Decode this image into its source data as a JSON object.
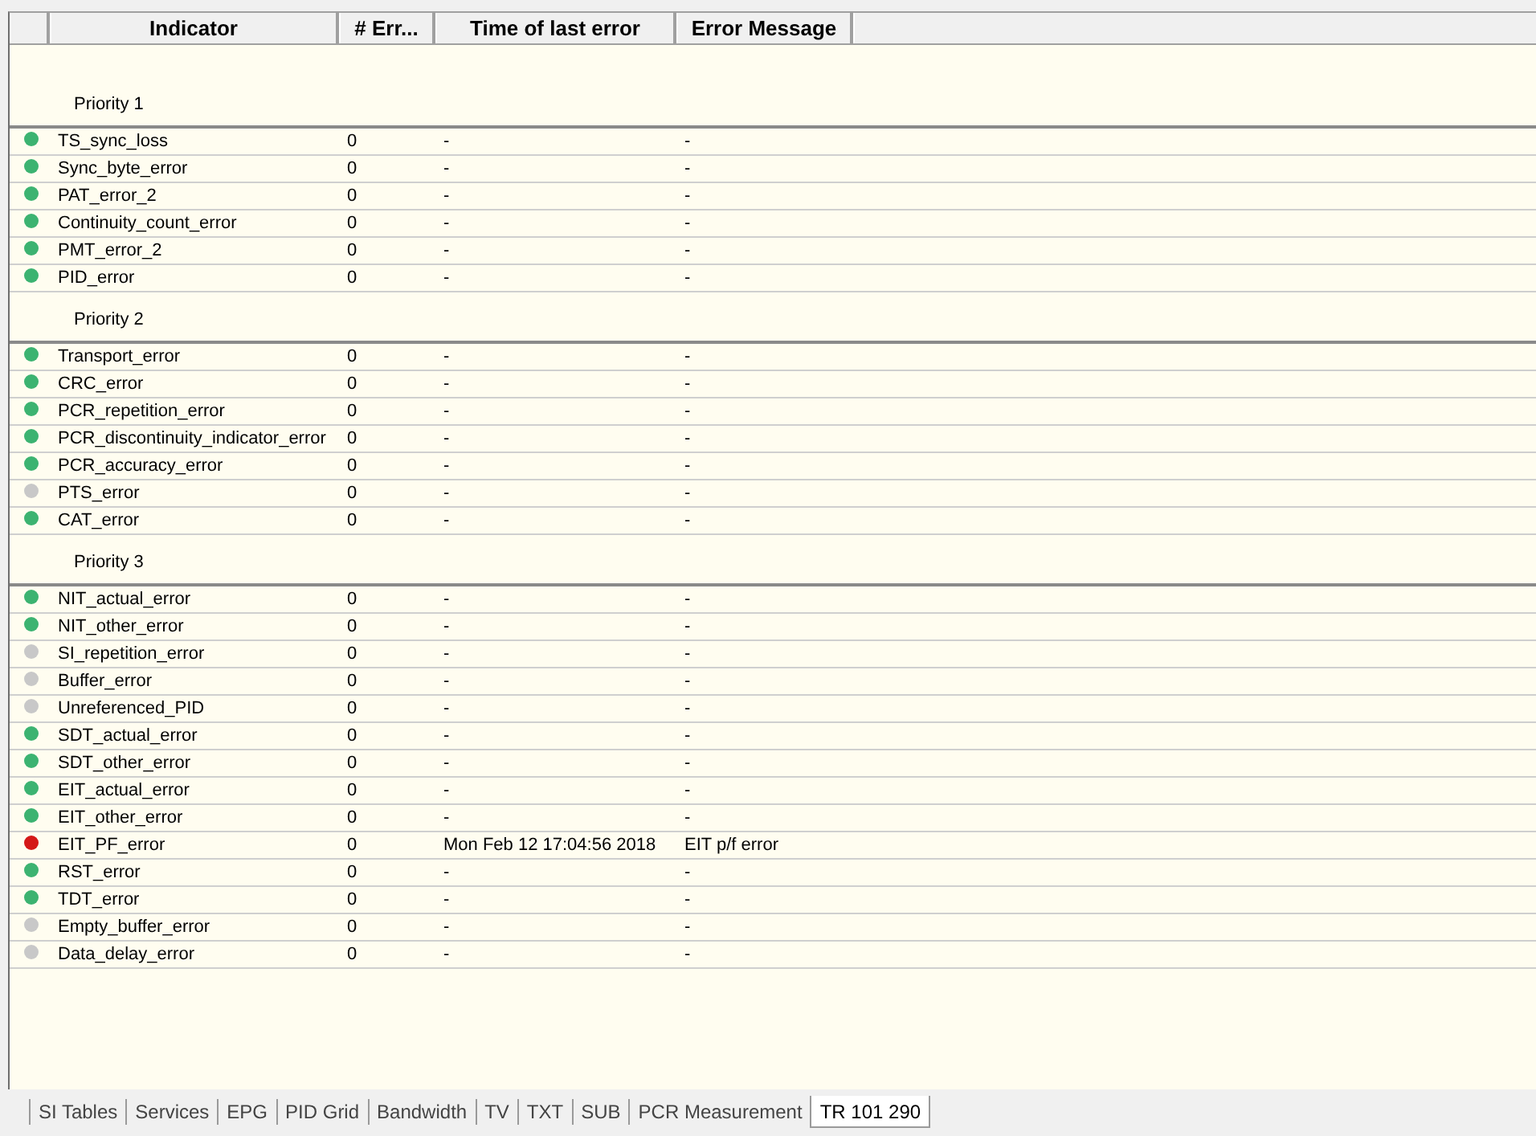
{
  "table": {
    "columns": [
      {
        "label": "Indicator"
      },
      {
        "label": "# Err..."
      },
      {
        "label": "Time of last error"
      },
      {
        "label": "Error Message"
      }
    ],
    "groups": [
      {
        "title": "Priority 1",
        "rows": [
          {
            "color": "#3cb371",
            "name": "TS_sync_loss",
            "count": "0",
            "time": "-",
            "message": "-"
          },
          {
            "color": "#3cb371",
            "name": "Sync_byte_error",
            "count": "0",
            "time": "-",
            "message": "-"
          },
          {
            "color": "#3cb371",
            "name": "PAT_error_2",
            "count": "0",
            "time": "-",
            "message": "-"
          },
          {
            "color": "#3cb371",
            "name": "Continuity_count_error",
            "count": "0",
            "time": "-",
            "message": "-"
          },
          {
            "color": "#3cb371",
            "name": "PMT_error_2",
            "count": "0",
            "time": "-",
            "message": "-"
          },
          {
            "color": "#3cb371",
            "name": "PID_error",
            "count": "0",
            "time": "-",
            "message": "-"
          }
        ]
      },
      {
        "title": "Priority 2",
        "rows": [
          {
            "color": "#3cb371",
            "name": "Transport_error",
            "count": "0",
            "time": "-",
            "message": "-"
          },
          {
            "color": "#3cb371",
            "name": "CRC_error",
            "count": "0",
            "time": "-",
            "message": "-"
          },
          {
            "color": "#3cb371",
            "name": "PCR_repetition_error",
            "count": "0",
            "time": "-",
            "message": "-"
          },
          {
            "color": "#3cb371",
            "name": "PCR_discontinuity_indicator_error",
            "count": "0",
            "time": "-",
            "message": "-"
          },
          {
            "color": "#3cb371",
            "name": "PCR_accuracy_error",
            "count": "0",
            "time": "-",
            "message": "-"
          },
          {
            "color": "#c8c8c8",
            "name": "PTS_error",
            "count": "0",
            "time": "-",
            "message": "-"
          },
          {
            "color": "#3cb371",
            "name": "CAT_error",
            "count": "0",
            "time": "-",
            "message": "-"
          }
        ]
      },
      {
        "title": "Priority 3",
        "rows": [
          {
            "color": "#3cb371",
            "name": "NIT_actual_error",
            "count": "0",
            "time": "-",
            "message": "-"
          },
          {
            "color": "#3cb371",
            "name": "NIT_other_error",
            "count": "0",
            "time": "-",
            "message": "-"
          },
          {
            "color": "#c8c8c8",
            "name": "SI_repetition_error",
            "count": "0",
            "time": "-",
            "message": "-"
          },
          {
            "color": "#c8c8c8",
            "name": "Buffer_error",
            "count": "0",
            "time": "-",
            "message": "-"
          },
          {
            "color": "#c8c8c8",
            "name": "Unreferenced_PID",
            "count": "0",
            "time": "-",
            "message": "-"
          },
          {
            "color": "#3cb371",
            "name": "SDT_actual_error",
            "count": "0",
            "time": "-",
            "message": "-"
          },
          {
            "color": "#3cb371",
            "name": "SDT_other_error",
            "count": "0",
            "time": "-",
            "message": "-"
          },
          {
            "color": "#3cb371",
            "name": "EIT_actual_error",
            "count": "0",
            "time": "-",
            "message": "-"
          },
          {
            "color": "#3cb371",
            "name": "EIT_other_error",
            "count": "0",
            "time": "-",
            "message": "-"
          },
          {
            "color": "#d41818",
            "name": "EIT_PF_error",
            "count": "0",
            "time": "Mon Feb 12 17:04:56 2018",
            "message": "EIT p/f error"
          },
          {
            "color": "#3cb371",
            "name": "RST_error",
            "count": "0",
            "time": "-",
            "message": "-"
          },
          {
            "color": "#3cb371",
            "name": "TDT_error",
            "count": "0",
            "time": "-",
            "message": "-"
          },
          {
            "color": "#c8c8c8",
            "name": "Empty_buffer_error",
            "count": "0",
            "time": "-",
            "message": "-"
          },
          {
            "color": "#c8c8c8",
            "name": "Data_delay_error",
            "count": "0",
            "time": "-",
            "message": "-"
          }
        ]
      }
    ]
  },
  "tabs": [
    {
      "label": "SI Tables",
      "selected": false
    },
    {
      "label": "Services",
      "selected": false
    },
    {
      "label": "EPG",
      "selected": false
    },
    {
      "label": "PID Grid",
      "selected": false
    },
    {
      "label": "Bandwidth",
      "selected": false
    },
    {
      "label": "TV",
      "selected": false
    },
    {
      "label": "TXT",
      "selected": false
    },
    {
      "label": "SUB",
      "selected": false
    },
    {
      "label": "PCR Measurement",
      "selected": false
    },
    {
      "label": "TR 101 290",
      "selected": true
    }
  ]
}
